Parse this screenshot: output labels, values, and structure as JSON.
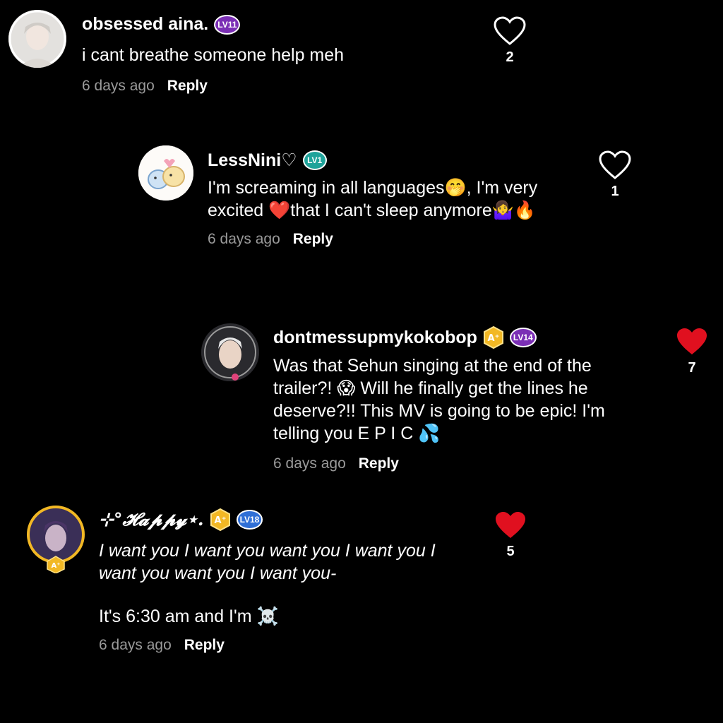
{
  "colors": {
    "background": "#000000",
    "text": "#ffffff",
    "timestamp": "#9a9a9a",
    "liked_heart": "#e0101f",
    "level_purple": "#7b2fb5",
    "level_teal": "#1fa39a",
    "level_blue": "#2f6fd6",
    "badge_gold": "#f2b824"
  },
  "comments": [
    {
      "username": "obsessed aina.",
      "level": "LV11",
      "level_color": "purple",
      "text": "i cant breathe someone help meh",
      "timestamp": "6 days ago",
      "reply_label": "Reply",
      "likes": "2",
      "liked": false,
      "avatar_icon": "user-avatar-photo"
    },
    {
      "username": "LessNini♡",
      "level": "LV1",
      "level_color": "teal",
      "text_line1": "I'm screaming in all languages🤭, I'm very",
      "text_line2": "excited ❤️that I can't sleep anymore🤷‍♀️🔥",
      "timestamp": "6 days ago",
      "reply_label": "Reply",
      "likes": "1",
      "liked": false,
      "avatar_icon": "cartoon-couple-avatar"
    },
    {
      "username": "dontmessupmykokobop",
      "level": "LV14",
      "level_color": "purple",
      "has_a_badge": true,
      "text_line1": "Was that Sehun singing at the end of the",
      "text_line2": "trailer?! 😱 Will he finally get the lines he",
      "text_line3": "deserve?!! This MV is going to be epic! I'm",
      "text_line4": "telling you E P I C 💦",
      "timestamp": "6 days ago",
      "reply_label": "Reply",
      "likes": "7",
      "liked": true,
      "avatar_icon": "user-avatar-photo"
    },
    {
      "username": "⊹°𝓗𝓪𝓹𝓹𝔂⋆.",
      "level": "LV18",
      "level_color": "blue",
      "has_a_badge": true,
      "text_line1": "I want you I want you want you I want you I",
      "text_line2": "want you want you I want you-",
      "text_line3": "It's 6:30 am and I'm ☠️",
      "timestamp": "6 days ago",
      "reply_label": "Reply",
      "likes": "5",
      "liked": true,
      "avatar_icon": "user-avatar-photo"
    }
  ]
}
